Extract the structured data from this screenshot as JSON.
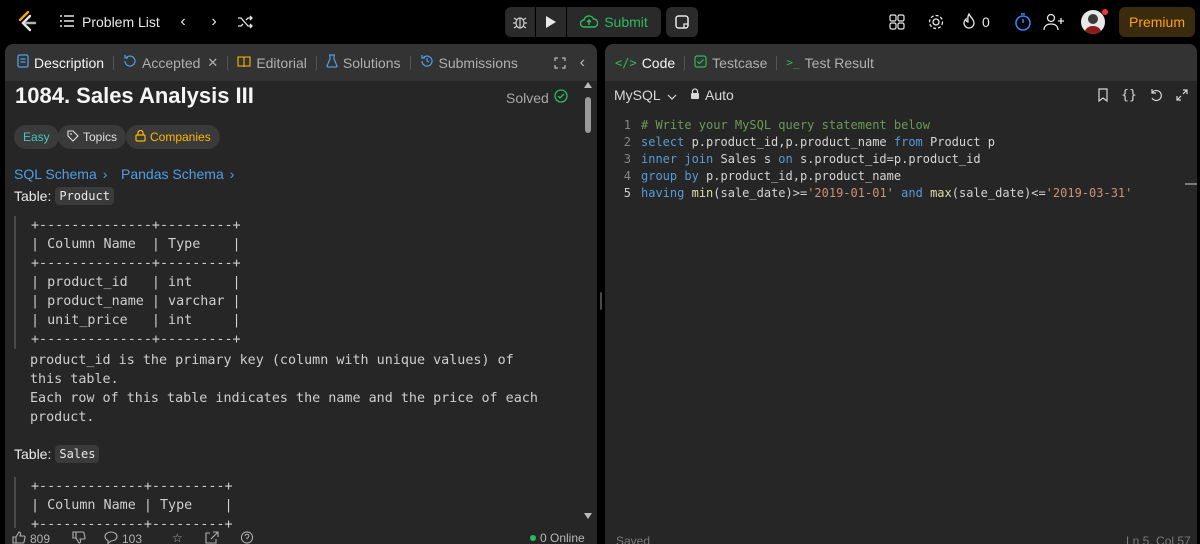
{
  "topbar": {
    "problem_list": "Problem List",
    "submit": "Submit",
    "streak_count": "0",
    "premium": "Premium"
  },
  "left_tabs": {
    "description": "Description",
    "accepted": "Accepted",
    "editorial": "Editorial",
    "solutions": "Solutions",
    "submissions": "Submissions"
  },
  "problem": {
    "title": "1084. Sales Analysis III",
    "status": "Solved",
    "difficulty": "Easy",
    "topics": "Topics",
    "companies": "Companies",
    "sql_schema": "SQL Schema",
    "pandas_schema": "Pandas Schema",
    "table1_label": "Table:",
    "table1_name": "Product",
    "product_table": [
      "+--------------+---------+",
      "| Column Name  | Type    |",
      "+--------------+---------+",
      "| product_id   | int     |",
      "| product_name | varchar |",
      "| unit_price   | int     |",
      "+--------------+---------+"
    ],
    "description_lines": [
      "product_id is the primary key (column with unique values) of",
      "this table.",
      "Each row of this table indicates the name and the price of each",
      "product."
    ],
    "table2_label": "Table:",
    "table2_name": "Sales",
    "sales_table": [
      "+-------------+---------+",
      "| Column Name | Type    |",
      "+-------------+---------+"
    ]
  },
  "footer_left": {
    "likes": "809",
    "comments": "103",
    "online": "0 Online"
  },
  "right_tabs": {
    "code": "Code",
    "testcase": "Testcase",
    "test_result": "Test Result"
  },
  "editor": {
    "language": "MySQL",
    "auto": "Auto",
    "line_numbers": [
      "1",
      "2",
      "3",
      "4",
      "5"
    ],
    "status": "Saved",
    "cursor": "Ln 5, Col 57"
  },
  "colors": {
    "accent_green": "#2cbb5d",
    "premium_orange": "#ffa116",
    "easy_teal": "#46c6c2",
    "companies_yellow": "#ffb800",
    "link_blue": "#4f9ee8"
  },
  "icons": [
    "leetcode-logo-icon",
    "list-icon",
    "chevron-left-icon",
    "chevron-right-icon",
    "shuffle-icon",
    "bug-icon",
    "play-icon",
    "cloud-upload-icon",
    "notes-icon",
    "layout-icon",
    "gear-icon",
    "fire-icon",
    "timer-icon",
    "add-user-icon",
    "document-icon",
    "flask-icon",
    "book-icon",
    "history-icon",
    "tag-icon",
    "lock-icon",
    "code-icon",
    "checkbox-icon",
    "terminal-icon",
    "bookmark-icon",
    "braces-icon",
    "undo-icon",
    "expand-icon",
    "thumbs-up-icon",
    "thumbs-down-icon",
    "comment-icon",
    "star-icon",
    "share-icon",
    "help-icon",
    "check-circle-icon"
  ]
}
